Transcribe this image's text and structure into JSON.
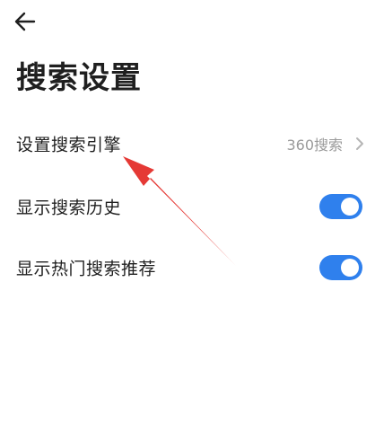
{
  "header": {
    "back_icon": "arrow-left-icon",
    "title": "搜索设置"
  },
  "settings": [
    {
      "label": "设置搜索引擎",
      "value": "360搜索",
      "control": "chevron-right-icon"
    },
    {
      "label": "显示搜索历史",
      "toggle_on": true
    },
    {
      "label": "显示热门搜索推荐",
      "toggle_on": true
    }
  ],
  "colors": {
    "toggle_on": "#2f80ed",
    "annotation_arrow": "#e53935",
    "secondary_text": "#9a9a9a"
  }
}
